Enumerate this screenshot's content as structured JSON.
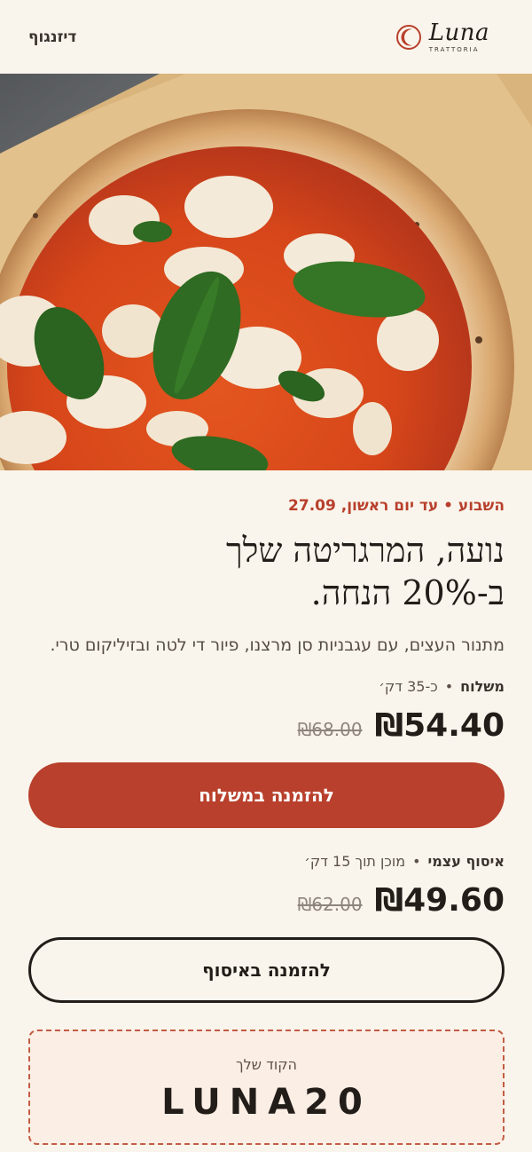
{
  "header": {
    "location": "דיזנגוף",
    "brand_name": "Luna",
    "brand_sub": "TRATTORIA"
  },
  "hero": {
    "image_alt": "pizza-margherita-photo"
  },
  "promo": {
    "tag": "השבוע • עד יום ראשון, 27.09",
    "headline_line1": "נועה, המרגריטה שלך",
    "headline_line2": "ב-20% הנחה.",
    "description": "מתנור העצים, עם עגבניות סן מרצנו, פיור די לטה ובזיליקום טרי."
  },
  "delivery": {
    "label": "משלוח",
    "time": "כ-35 דק׳",
    "price_new": "₪54.40",
    "price_old": "₪68.00",
    "button": "להזמנה במשלוח"
  },
  "pickup": {
    "label": "איסוף עצמי",
    "time": "מוכן תוך 15 דק׳",
    "price_new": "₪49.60",
    "price_old": "₪62.00",
    "button": "להזמנה באיסוף"
  },
  "coupon": {
    "label": "הקוד שלך",
    "code": "LUNA20"
  },
  "colors": {
    "accent": "#b8402c",
    "background": "#faf5ec",
    "text": "#231d19"
  }
}
